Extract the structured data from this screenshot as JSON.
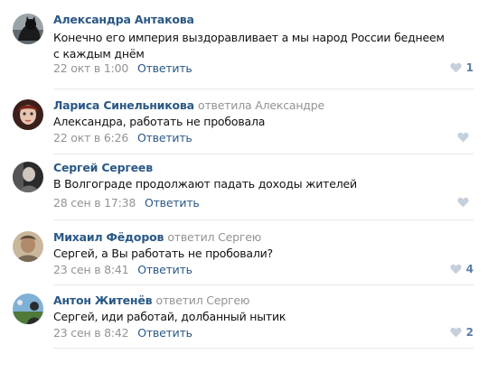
{
  "comments": [
    {
      "author": "Александра Антакова",
      "replied": "",
      "text": "Конечно его империя выздоравливает а мы народ России беднеем с каждым днём",
      "time": "22 окт в 1:00",
      "reply_label": "Ответить",
      "likes": "1"
    },
    {
      "author": "Лариса Синельникова",
      "replied": "ответила Александре",
      "text": "Александра, работать не пробовала",
      "time": "22 окт в 6:26",
      "reply_label": "Ответить",
      "likes": ""
    },
    {
      "author": "Сергей Сергеев",
      "replied": "",
      "text": "В Волгограде продолжают падать доходы жителей",
      "time": "28 сен в 17:38",
      "reply_label": "Ответить",
      "likes": ""
    },
    {
      "author": "Михаил Фёдоров",
      "replied": "ответил Сергею",
      "text": "Сергей, а Вы работать не пробовали?",
      "time": "23 сен в 8:41",
      "reply_label": "Ответить",
      "likes": "4"
    },
    {
      "author": "Антон Житенёв",
      "replied": "ответил Сергею",
      "text": "Сергей, иди работай, долбанный нытик",
      "time": "23 сен в 8:42",
      "reply_label": "Ответить",
      "likes": "2"
    }
  ]
}
